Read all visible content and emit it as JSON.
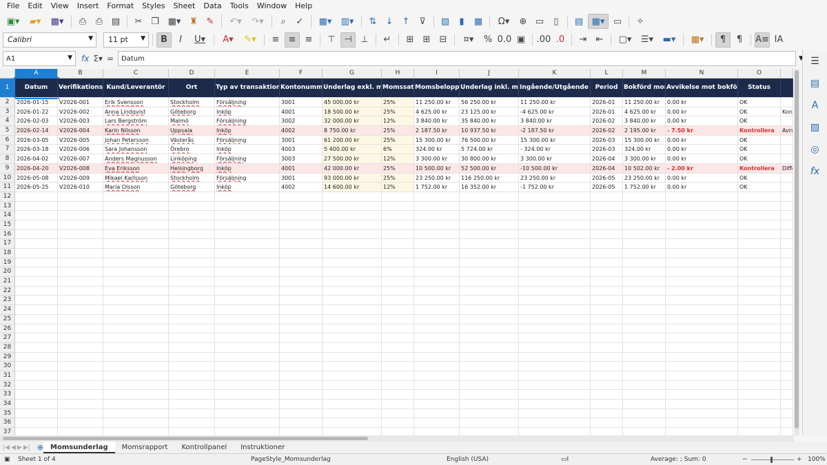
{
  "menu": [
    "File",
    "Edit",
    "View",
    "Insert",
    "Format",
    "Styles",
    "Sheet",
    "Data",
    "Tools",
    "Window",
    "Help"
  ],
  "font": {
    "name": "Calibri",
    "size": "11 pt"
  },
  "namebox": "A1",
  "formula": "Datum",
  "columns": [
    "A",
    "B",
    "C",
    "D",
    "E",
    "F",
    "G",
    "H",
    "I",
    "J",
    "K",
    "L",
    "M",
    "N",
    "O",
    ""
  ],
  "headers": [
    "Datum",
    "Verifikationsnr",
    "Kund/Leverantör",
    "Ort",
    "Typ av transaktion",
    "Kontonummer",
    "Underlag exkl. moms",
    "Momssats",
    "Momsbelopp",
    "Underlag inkl. moms",
    "Ingående/Utgående moms",
    "Period",
    "Bokförd moms",
    "Avvikelse mot bokföring",
    "Status",
    ""
  ],
  "rows": [
    [
      "2026-01-15",
      "V2026-001",
      "Erik Svensson",
      "Stockholm",
      "Försäljning",
      "3001",
      "45 000.00 kr",
      "25%",
      "11 250.00 kr",
      "56 250.00 kr",
      "11 250.00 kr",
      "2026-01",
      "11 250.00 kr",
      "0.00 kr",
      "OK",
      ""
    ],
    [
      "2026-01-22",
      "V2026-002",
      "Anna Lindqvist",
      "Göteborg",
      "Inköp",
      "4001",
      "18 500.00 kr",
      "25%",
      "4 625.00 kr",
      "23 125.00 kr",
      "-4 625.00 kr",
      "2026-01",
      "4 625.00 kr",
      "0.00 kr",
      "OK",
      "Kont"
    ],
    [
      "2026-02-03",
      "V2026-003",
      "Lars Bergström",
      "Malmö",
      "Försäljning",
      "3002",
      "32 000.00 kr",
      "12%",
      "3 840.00 kr",
      "35 840.00 kr",
      "3 840.00 kr",
      "2026-02",
      "3 840.00 kr",
      "0.00 kr",
      "OK",
      ""
    ],
    [
      "2026-02-14",
      "V2026-004",
      "Karin Nilsson",
      "Uppsala",
      "Inköp",
      "4002",
      "8 750.00 kr",
      "25%",
      "2 187.50 kr",
      "10 937.50 kr",
      "-2 187.50 kr",
      "2026-02",
      "2 195.00 kr",
      "- 7.50 kr",
      "Kontrollera",
      "Avru"
    ],
    [
      "2026-03-05",
      "V2026-005",
      "Johan Petersson",
      "Västerås",
      "Försäljning",
      "3001",
      "61 200.00 kr",
      "25%",
      "15 300.00 kr",
      "76 500.00 kr",
      "15 300.00 kr",
      "2026-03",
      "15 300.00 kr",
      "0.00 kr",
      "OK",
      ""
    ],
    [
      "2026-03-18",
      "V2026-006",
      "Sara Johansson",
      "Örebro",
      "Inköp",
      "4003",
      "5 400.00 kr",
      "6%",
      "324.00 kr",
      "5 724.00 kr",
      "- 324.00 kr",
      "2026-03",
      "324.00 kr",
      "0.00 kr",
      "OK",
      ""
    ],
    [
      "2026-04-02",
      "V2026-007",
      "Anders Magnusson",
      "Linköping",
      "Försäljning",
      "3003",
      "27 500.00 kr",
      "12%",
      "3 300.00 kr",
      "30 800.00 kr",
      "3 300.00 kr",
      "2026-04",
      "3 300.00 kr",
      "0.00 kr",
      "OK",
      ""
    ],
    [
      "2026-04-20",
      "V2026-008",
      "Eva Eriksson",
      "Helsingborg",
      "Inköp",
      "4001",
      "42 000.00 kr",
      "25%",
      "10 500.00 kr",
      "52 500.00 kr",
      "-10 500.00 kr",
      "2026-04",
      "10 502.00 kr",
      "- 2.00 kr",
      "Kontrollera",
      "Diffe"
    ],
    [
      "2026-05-08",
      "V2026-009",
      "Mikael Karlsson",
      "Stockholm",
      "Försäljning",
      "3001",
      "93 000.00 kr",
      "25%",
      "23 250.00 kr",
      "116 250.00 kr",
      "23 250.00 kr",
      "2026-05",
      "23 250.00 kr",
      "0.00 kr",
      "OK",
      ""
    ],
    [
      "2026-05-25",
      "V2026-010",
      "Maria Olsson",
      "Göteborg",
      "Inköp",
      "4002",
      "14 600.00 kr",
      "12%",
      "1 752.00 kr",
      "16 352.00 kr",
      "-1 752.00 kr",
      "2026-05",
      "1 752.00 kr",
      "0.00 kr",
      "OK",
      ""
    ]
  ],
  "empty_row_numbers": [
    "12",
    "13",
    "14",
    "15",
    "16",
    "17",
    "18",
    "19",
    "20",
    "21",
    "22",
    "23",
    "24",
    "25",
    "26",
    "27",
    "28",
    "29",
    "30",
    "31",
    "32",
    "33",
    "34",
    "35",
    "36",
    "37"
  ],
  "tabs": [
    "Momsunderlag",
    "Momsrapport",
    "Kontrollpanel",
    "Instruktioner"
  ],
  "active_tab": "Momsunderlag",
  "status": {
    "sheet": "Sheet 1 of 4",
    "page_style": "PageStyle_Momsunderlag",
    "language": "English (USA)",
    "summary": "Average: ; Sum: 0",
    "zoom": "100%"
  },
  "colors": {
    "header_bg": "#1d2b4a",
    "selection": "#1f7fd1",
    "warn_bg": "#fde6e6",
    "warn_text": "#d23030",
    "input_bg": "#fdf8e3"
  }
}
